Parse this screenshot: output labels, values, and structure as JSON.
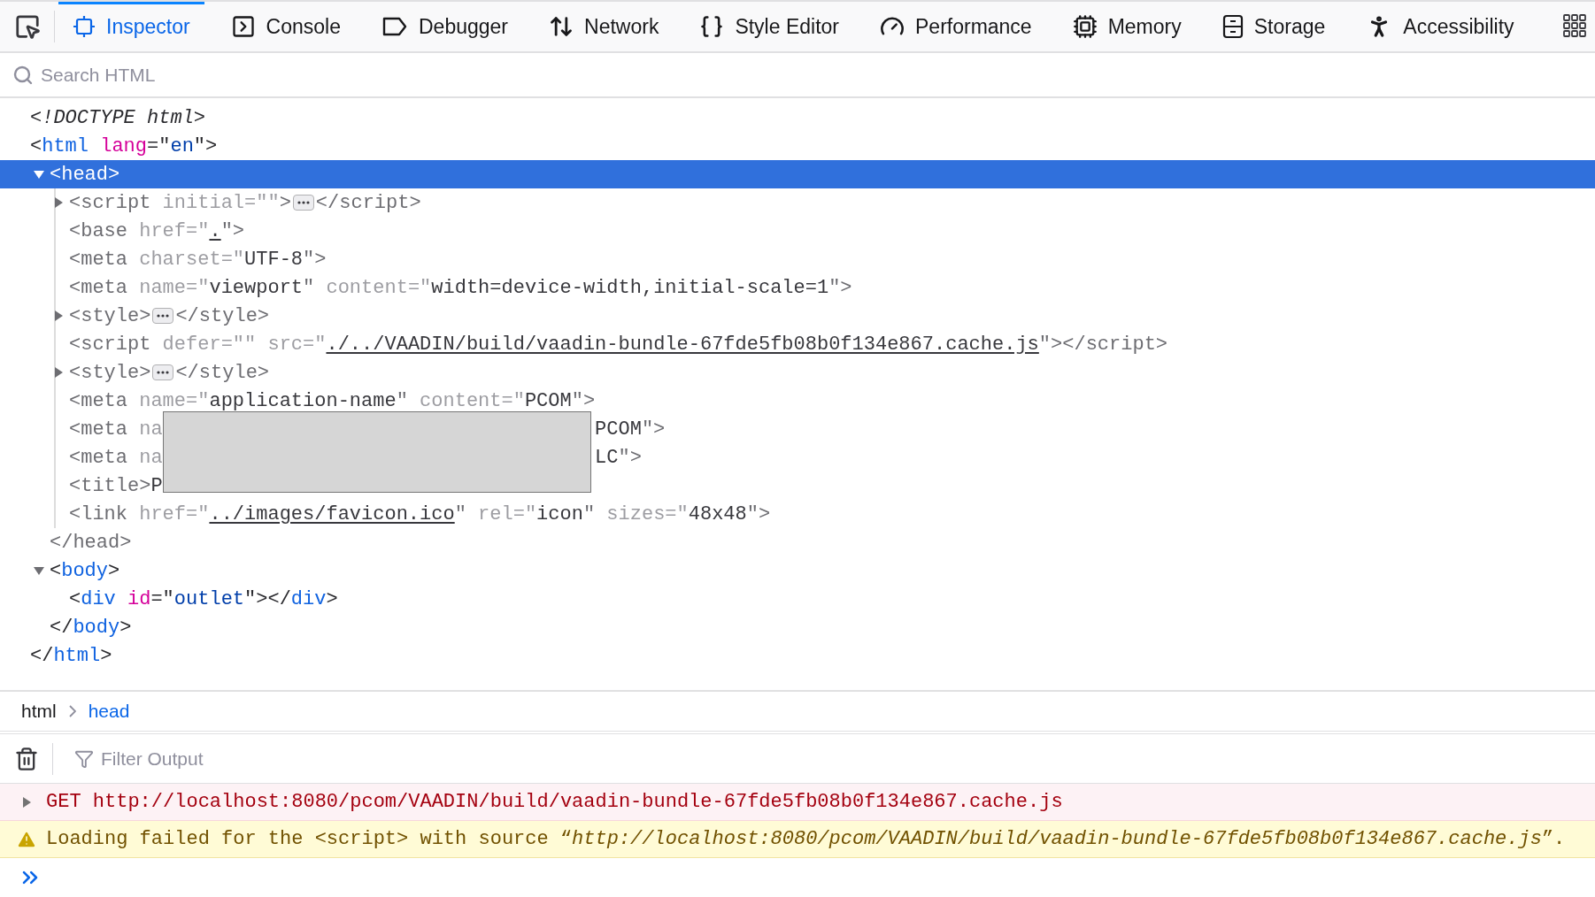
{
  "toolbar": {
    "tabs": [
      {
        "label": "Inspector",
        "selected": true
      },
      {
        "label": "Console",
        "selected": false
      },
      {
        "label": "Debugger",
        "selected": false
      },
      {
        "label": "Network",
        "selected": false
      },
      {
        "label": "Style Editor",
        "selected": false
      },
      {
        "label": "Performance",
        "selected": false
      },
      {
        "label": "Memory",
        "selected": false
      },
      {
        "label": "Storage",
        "selected": false
      },
      {
        "label": "Accessibility",
        "selected": false
      }
    ]
  },
  "search": {
    "placeholder": "Search HTML"
  },
  "markup": {
    "nodes": [
      {
        "selected": false,
        "dimmed": false,
        "open": [
          {
            "kind": "doctype",
            "text": "<!DOCTYPE html>"
          }
        ]
      },
      {
        "selected": false,
        "dimmed": false,
        "open": [
          {
            "kind": "punct",
            "text": "<"
          },
          {
            "kind": "tag",
            "text": "html"
          },
          {
            "kind": "attr",
            "text": " lang"
          },
          {
            "kind": "punct",
            "text": "=\""
          },
          {
            "kind": "value",
            "text": "en"
          },
          {
            "kind": "punct",
            "text": "\">"
          }
        ],
        "close": [
          {
            "kind": "punct",
            "text": "</"
          },
          {
            "kind": "tag",
            "text": "html"
          },
          {
            "kind": "punct",
            "text": ">"
          }
        ],
        "children": [
          {
            "selected": true,
            "dimmed": true,
            "expanded": true,
            "open": [
              {
                "kind": "punct",
                "text": "<"
              },
              {
                "kind": "tag",
                "text": "head"
              },
              {
                "kind": "punct",
                "text": ">"
              }
            ],
            "close": [
              {
                "kind": "punct",
                "text": "</"
              },
              {
                "kind": "tag",
                "text": "head"
              },
              {
                "kind": "punct",
                "text": ">"
              }
            ],
            "children": [
              {
                "selected": false,
                "dimmed": true,
                "expanded": false,
                "open": [
                  {
                    "kind": "punct",
                    "text": "<"
                  },
                  {
                    "kind": "tag",
                    "text": "script"
                  },
                  {
                    "kind": "attr",
                    "text": " initial=\"\""
                  },
                  {
                    "kind": "punct",
                    "text": ">"
                  },
                  {
                    "kind": "collapsed"
                  },
                  {
                    "kind": "punct",
                    "text": "</"
                  },
                  {
                    "kind": "tag",
                    "text": "script"
                  },
                  {
                    "kind": "punct",
                    "text": ">"
                  }
                ]
              },
              {
                "selected": false,
                "dimmed": true,
                "open": [
                  {
                    "kind": "punct",
                    "text": "<"
                  },
                  {
                    "kind": "tag",
                    "text": "base"
                  },
                  {
                    "kind": "attr",
                    "text": " href=\""
                  },
                  {
                    "kind": "link",
                    "text": "."
                  },
                  {
                    "kind": "punct",
                    "text": "\">"
                  }
                ]
              },
              {
                "selected": false,
                "dimmed": true,
                "open": [
                  {
                    "kind": "punct",
                    "text": "<"
                  },
                  {
                    "kind": "tag",
                    "text": "meta"
                  },
                  {
                    "kind": "attr",
                    "text": " charset=\""
                  },
                  {
                    "kind": "value",
                    "text": "UTF-8"
                  },
                  {
                    "kind": "punct",
                    "text": "\">"
                  }
                ]
              },
              {
                "selected": false,
                "dimmed": true,
                "open": [
                  {
                    "kind": "punct",
                    "text": "<"
                  },
                  {
                    "kind": "tag",
                    "text": "meta"
                  },
                  {
                    "kind": "attr",
                    "text": " name=\""
                  },
                  {
                    "kind": "value",
                    "text": "viewport"
                  },
                  {
                    "kind": "punct",
                    "text": "\""
                  },
                  {
                    "kind": "attr",
                    "text": " content=\""
                  },
                  {
                    "kind": "value",
                    "text": "width=device-width,initial-scale=1"
                  },
                  {
                    "kind": "punct",
                    "text": "\">"
                  }
                ]
              },
              {
                "selected": false,
                "dimmed": true,
                "expanded": false,
                "open": [
                  {
                    "kind": "punct",
                    "text": "<"
                  },
                  {
                    "kind": "tag",
                    "text": "style"
                  },
                  {
                    "kind": "punct",
                    "text": ">"
                  },
                  {
                    "kind": "collapsed"
                  },
                  {
                    "kind": "punct",
                    "text": "</"
                  },
                  {
                    "kind": "tag",
                    "text": "style"
                  },
                  {
                    "kind": "punct",
                    "text": ">"
                  }
                ]
              },
              {
                "selected": false,
                "dimmed": true,
                "open": [
                  {
                    "kind": "punct",
                    "text": "<"
                  },
                  {
                    "kind": "tag",
                    "text": "script"
                  },
                  {
                    "kind": "attr",
                    "text": " defer=\"\" src=\""
                  },
                  {
                    "kind": "link",
                    "text": "./../VAADIN/build/vaadin-bundle-67fde5fb08b0f134e867.cache.js"
                  },
                  {
                    "kind": "punct",
                    "text": "\"></"
                  },
                  {
                    "kind": "tag",
                    "text": "script"
                  },
                  {
                    "kind": "punct",
                    "text": ">"
                  }
                ]
              },
              {
                "selected": false,
                "dimmed": true,
                "expanded": false,
                "open": [
                  {
                    "kind": "punct",
                    "text": "<"
                  },
                  {
                    "kind": "tag",
                    "text": "style"
                  },
                  {
                    "kind": "punct",
                    "text": ">"
                  },
                  {
                    "kind": "collapsed"
                  },
                  {
                    "kind": "punct",
                    "text": "</"
                  },
                  {
                    "kind": "tag",
                    "text": "style"
                  },
                  {
                    "kind": "punct",
                    "text": ">"
                  }
                ]
              },
              {
                "selected": false,
                "dimmed": true,
                "open": [
                  {
                    "kind": "punct",
                    "text": "<"
                  },
                  {
                    "kind": "tag",
                    "text": "meta"
                  },
                  {
                    "kind": "attr",
                    "text": " name=\""
                  },
                  {
                    "kind": "value",
                    "text": "application-name"
                  },
                  {
                    "kind": "punct",
                    "text": "\""
                  },
                  {
                    "kind": "attr",
                    "text": " content=\""
                  },
                  {
                    "kind": "value",
                    "text": "PCOM"
                  },
                  {
                    "kind": "punct",
                    "text": "\">"
                  }
                ]
              },
              {
                "selected": false,
                "dimmed": true,
                "open": [
                  {
                    "kind": "punct",
                    "text": "<"
                  },
                  {
                    "kind": "tag",
                    "text": "meta"
                  },
                  {
                    "kind": "attr",
                    "text": " na"
                  },
                  {
                    "kind": "redaction_start"
                  },
                  {
                    "kind": "value",
                    "text": "PCOM"
                  },
                  {
                    "kind": "punct",
                    "text": "\">"
                  }
                ]
              },
              {
                "selected": false,
                "dimmed": true,
                "open": [
                  {
                    "kind": "punct",
                    "text": "<"
                  },
                  {
                    "kind": "tag",
                    "text": "meta"
                  },
                  {
                    "kind": "attr",
                    "text": " na"
                  },
                  {
                    "kind": "redacted"
                  },
                  {
                    "kind": "value",
                    "text": "LC"
                  },
                  {
                    "kind": "punct",
                    "text": "\">"
                  }
                ]
              },
              {
                "selected": false,
                "dimmed": true,
                "open": [
                  {
                    "kind": "punct",
                    "text": "<"
                  },
                  {
                    "kind": "tag",
                    "text": "title"
                  },
                  {
                    "kind": "punct",
                    "text": ">"
                  },
                  {
                    "kind": "value",
                    "text": "P"
                  },
                  {
                    "kind": "redacted"
                  }
                ]
              },
              {
                "selected": false,
                "dimmed": true,
                "open": [
                  {
                    "kind": "punct",
                    "text": "<"
                  },
                  {
                    "kind": "tag",
                    "text": "link"
                  },
                  {
                    "kind": "attr",
                    "text": " href=\""
                  },
                  {
                    "kind": "link",
                    "text": "../images/favicon.ico"
                  },
                  {
                    "kind": "punct",
                    "text": "\""
                  },
                  {
                    "kind": "attr",
                    "text": " rel=\""
                  },
                  {
                    "kind": "value",
                    "text": "icon"
                  },
                  {
                    "kind": "punct",
                    "text": "\""
                  },
                  {
                    "kind": "attr",
                    "text": " sizes=\""
                  },
                  {
                    "kind": "value",
                    "text": "48x48"
                  },
                  {
                    "kind": "punct",
                    "text": "\">"
                  }
                ]
              }
            ]
          },
          {
            "selected": false,
            "dimmed": false,
            "expanded": true,
            "open": [
              {
                "kind": "punct",
                "text": "<"
              },
              {
                "kind": "tag",
                "text": "body"
              },
              {
                "kind": "punct",
                "text": ">"
              }
            ],
            "close": [
              {
                "kind": "punct",
                "text": "</"
              },
              {
                "kind": "tag",
                "text": "body"
              },
              {
                "kind": "punct",
                "text": ">"
              }
            ],
            "children": [
              {
                "selected": false,
                "dimmed": false,
                "open": [
                  {
                    "kind": "punct",
                    "text": "<"
                  },
                  {
                    "kind": "tag",
                    "text": "div"
                  },
                  {
                    "kind": "attr",
                    "text": " id"
                  },
                  {
                    "kind": "punct",
                    "text": "=\""
                  },
                  {
                    "kind": "value",
                    "text": "outlet"
                  },
                  {
                    "kind": "punct",
                    "text": "\"></"
                  },
                  {
                    "kind": "tag",
                    "text": "div"
                  },
                  {
                    "kind": "punct",
                    "text": ">"
                  }
                ]
              }
            ]
          }
        ]
      }
    ]
  },
  "breadcrumbs": [
    {
      "label": "html",
      "selected": false
    },
    {
      "label": "head",
      "selected": true
    }
  ],
  "console": {
    "filter": {
      "placeholder": "Filter Output"
    },
    "messages": [
      {
        "kind": "error",
        "expanded": false,
        "text": "GET http://localhost:8080/pcom/VAADIN/build/vaadin-bundle-67fde5fb08b0f134e867.cache.js"
      },
      {
        "kind": "warning",
        "text": "Loading failed for the <script> with source “*http://localhost:8080/pcom/VAADIN/build/vaadin-bundle-67fde5fb08b0f134e867.cache.js*”."
      }
    ]
  }
}
